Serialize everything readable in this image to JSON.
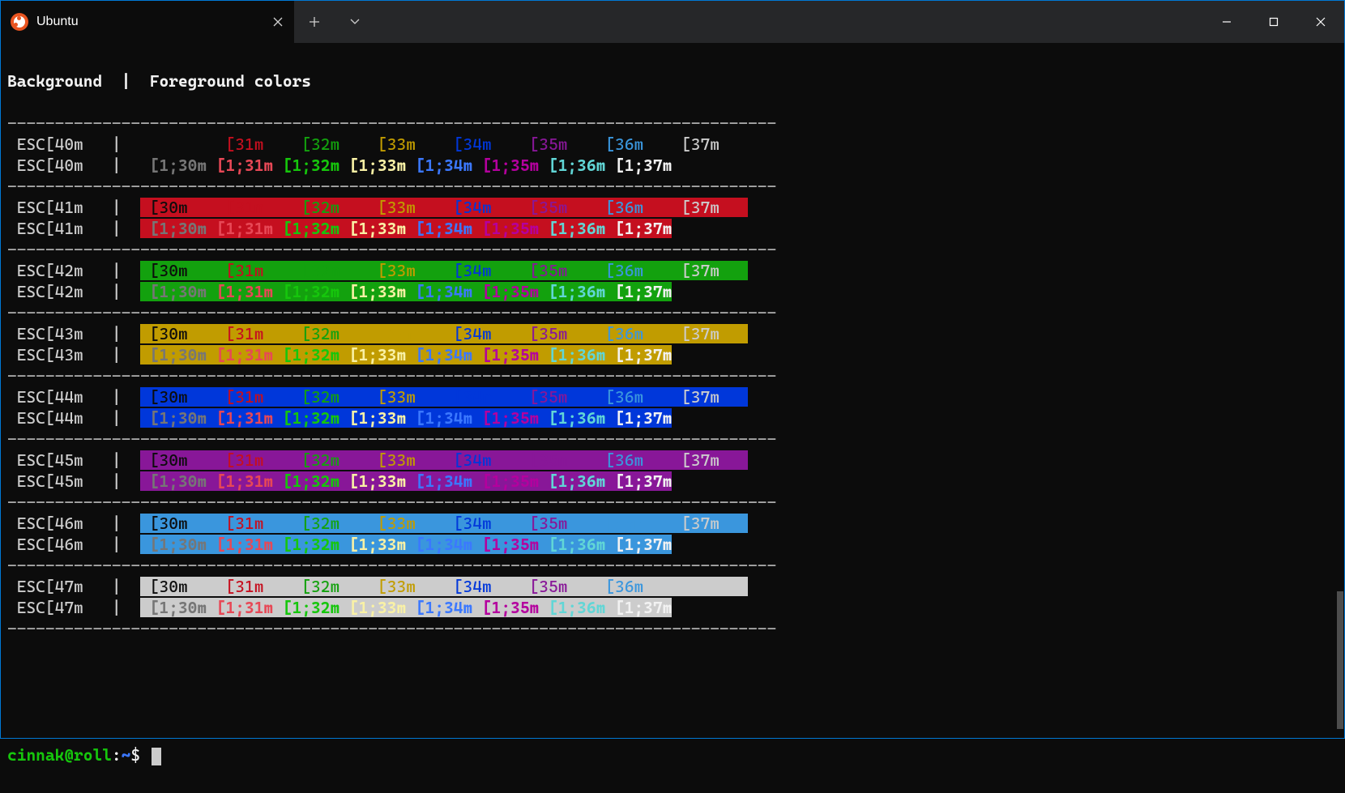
{
  "window": {
    "tab_title": "Ubuntu",
    "separator": "---------------------------------------------------------------------------------",
    "header_bg": "Background",
    "header_bar": "|",
    "header_fg": "Foreground colors"
  },
  "ansi": {
    "backgrounds": [
      40,
      41,
      42,
      43,
      44,
      45,
      46,
      47
    ],
    "normal_labels": [
      "[30m",
      "[31m",
      "[32m",
      "[33m",
      "[34m",
      "[35m",
      "[36m",
      "[37m"
    ],
    "bright_labels": [
      "[1;30m",
      "[1;31m",
      "[1;32m",
      "[1;33m",
      "[1;34m",
      "[1;35m",
      "[1;36m",
      "[1;37m"
    ],
    "bg_label_prefix": "ESC[",
    "bg_label_suffix": "m",
    "bar": "|"
  },
  "colors": {
    "bg": {
      "40": "#0c0c0c",
      "41": "#c50f1f",
      "42": "#13a10e",
      "43": "#c19c00",
      "44": "#0037da",
      "45": "#881798",
      "46": "#3a96dd",
      "47": "#cccccc"
    },
    "fg_normal": {
      "30": "#0c0c0c",
      "31": "#c50f1f",
      "32": "#13a10e",
      "33": "#c19c00",
      "34": "#0037da",
      "35": "#881798",
      "36": "#3a96dd",
      "37": "#cccccc"
    },
    "fg_bright": {
      "30": "#767676",
      "31": "#e74856",
      "32": "#16c60c",
      "33": "#f9f1a5",
      "34": "#3b78ff",
      "35": "#b4009e",
      "36": "#61d6d6",
      "37": "#f2f2f2"
    }
  },
  "prompt": {
    "user_host": "cinnak@roll",
    "colon": ":",
    "path": "~",
    "dollar": "$ "
  }
}
